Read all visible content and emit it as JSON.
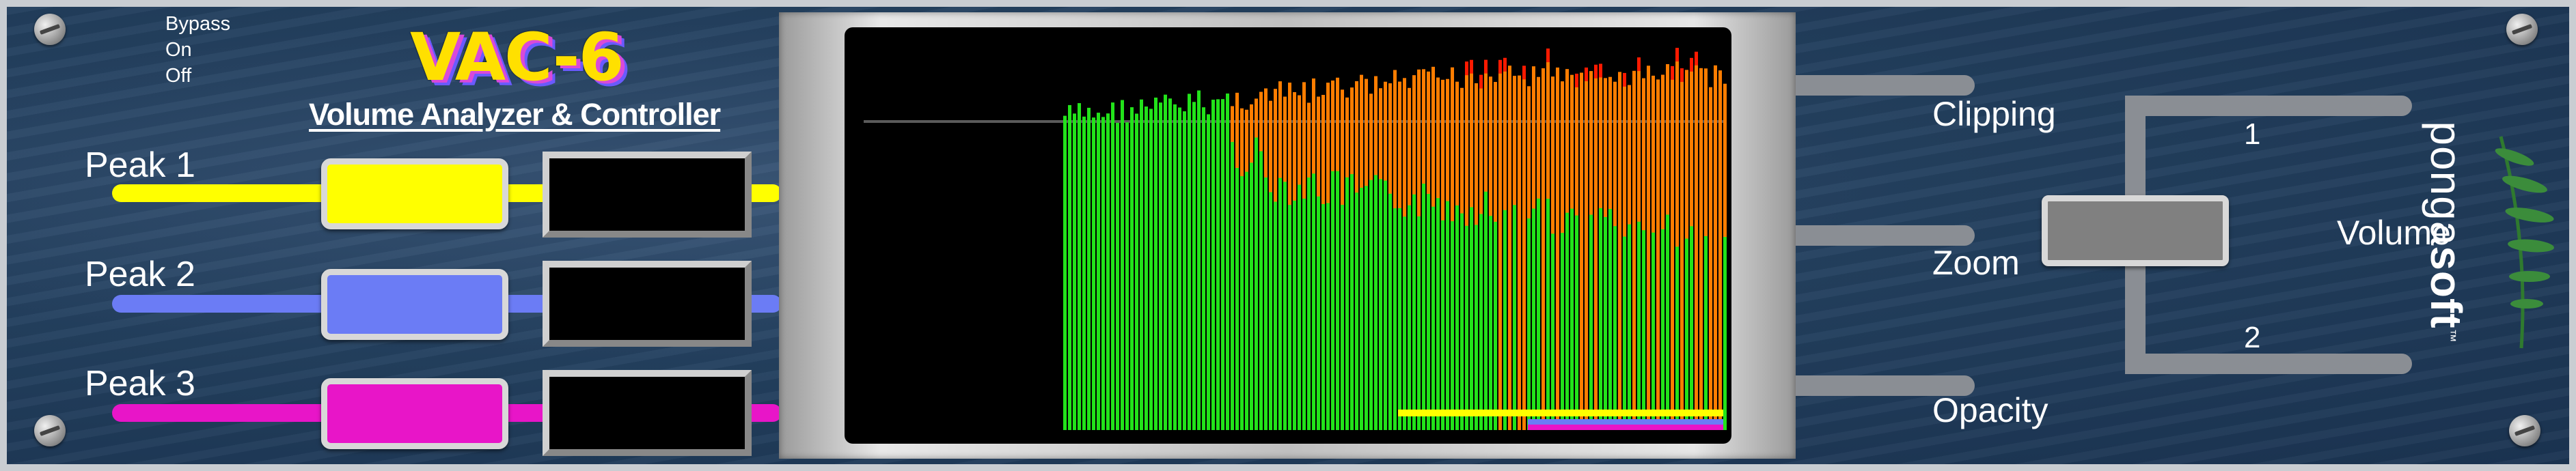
{
  "bypass": {
    "title": "Bypass",
    "options": [
      "On",
      "Off"
    ]
  },
  "logo": {
    "title": "VAC-6",
    "subtitle": "Volume Analyzer & Controller"
  },
  "peaks": [
    {
      "label": "Peak 1",
      "color": "#ffff00"
    },
    {
      "label": "Peak 2",
      "color": "#6b7cf5"
    },
    {
      "label": "Peak 3",
      "color": "#e815c8"
    }
  ],
  "controls": {
    "clipping": "Clipping",
    "zoom": "Zoom",
    "opacity": "Opacity"
  },
  "volume": {
    "label": "Volume",
    "option1": "1",
    "option2": "2"
  },
  "brand": {
    "name_light": "ponga",
    "name_bold": "soft",
    "tm": "™"
  },
  "colors": {
    "green": "#22e31a",
    "orange": "#ff7d00",
    "red": "#ff1a00"
  }
}
